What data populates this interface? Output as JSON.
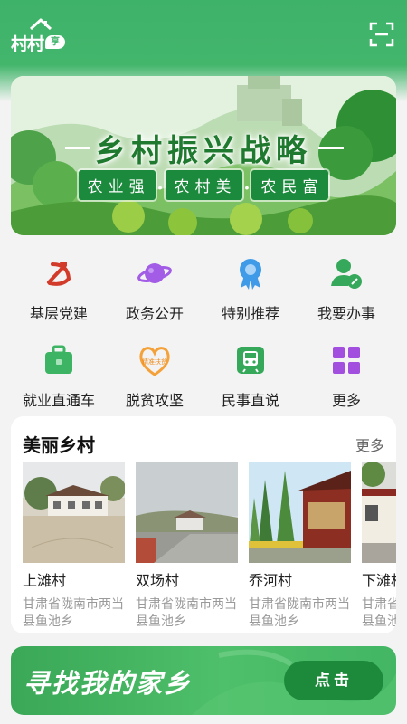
{
  "header": {
    "logo_text": "村村",
    "logo_badge": "享",
    "scan_icon": "scan-icon"
  },
  "banner": {
    "title": "乡村振兴战略",
    "slogans": [
      "农业强",
      "农村美",
      "农民富"
    ],
    "dot": "•"
  },
  "services": [
    {
      "label": "基层党建",
      "icon": "party-emblem-icon",
      "color": "#d23a2a"
    },
    {
      "label": "政务公开",
      "icon": "planet-icon",
      "color": "#a25ce6"
    },
    {
      "label": "特别推荐",
      "icon": "award-ribbon-icon",
      "color": "#3f9ae8"
    },
    {
      "label": "我要办事",
      "icon": "user-edit-icon",
      "color": "#36a85b"
    },
    {
      "label": "就业直通车",
      "icon": "briefcase-icon",
      "color": "#3cb463"
    },
    {
      "label": "脱贫攻坚",
      "icon": "heart-logo-icon",
      "color": "#f4a13a",
      "icon_text": "精准扶贫"
    },
    {
      "label": "民事直说",
      "icon": "train-icon",
      "color": "#35a85a"
    },
    {
      "label": "更多",
      "icon": "grid-more-icon",
      "color": "#a24fe0"
    }
  ],
  "villages_section": {
    "title": "美丽乡村",
    "more": "更多",
    "items": [
      {
        "name": "上滩村",
        "address": "甘肃省陇南市两当县鱼池乡"
      },
      {
        "name": "双场村",
        "address": "甘肃省陇南市两当县鱼池乡"
      },
      {
        "name": "乔河村",
        "address": "甘肃省陇南市两当县鱼池乡"
      },
      {
        "name": "下滩村",
        "address": "甘肃省陇南市两当县鱼池乡"
      }
    ]
  },
  "hometown": {
    "text": "寻找我的家乡",
    "button": "点击"
  },
  "colors": {
    "brand_green": "#3fb26a",
    "dark_green": "#1c8a3a"
  }
}
